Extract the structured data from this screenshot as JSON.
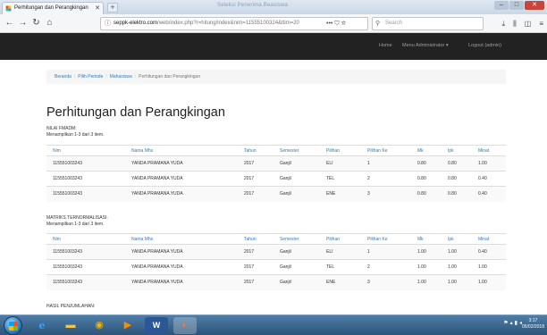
{
  "browser": {
    "tab_title": "Perhitungan dan Perangkingan",
    "window_title": "Seleksi Penerima Beasiswa",
    "url_host": "seppk-elektro.com",
    "url_path": "/web/index.php?r=hitung/index&nim=11555100324&ttim=20",
    "search_placeholder": "Search"
  },
  "sitenav": {
    "home": "Home",
    "menu_admin": "Menu Administrator ▾",
    "logout": "Logout (admin)"
  },
  "breadcrumb": {
    "items": [
      "Beranda",
      "Pilih Periode",
      "Mahasiswa"
    ],
    "active": "Perhitungan dan Perangkingan"
  },
  "page": {
    "title": "Perhitungan dan Perangkingan",
    "section1_label": "NILAI FMADM:",
    "section1_summary": "Menampilkan 1-3 dari 3 item.",
    "section2_label": "MATRIKS TERNORMALISASI:",
    "section2_summary": "Menampilkan 1-3 dari 3 item.",
    "section3_label": "HASIL PENJUMLAHAN:"
  },
  "columns": [
    "Nim",
    "Nama Mhs",
    "Tahun",
    "Semester",
    "Pilihan",
    "Pilihan Ke",
    "Mk",
    "Ipk",
    "Minat"
  ],
  "table1": [
    [
      "115551003243",
      "YANDA PRAMANA YUDA",
      "2017",
      "Ganjil",
      "ELI",
      "1",
      "0.80",
      "0.80",
      "1.00"
    ],
    [
      "115551003243",
      "YANDA PRAMANA YUDA",
      "2017",
      "Ganjil",
      "TEL",
      "2",
      "0.80",
      "0.80",
      "0.40"
    ],
    [
      "115551003243",
      "YANDA PRAMANA YUDA",
      "2017",
      "Ganjil",
      "ENE",
      "3",
      "0.80",
      "0.80",
      "0.40"
    ]
  ],
  "table2": [
    [
      "115551003243",
      "YANDA PRAMANA YUDA",
      "2017",
      "Ganjil",
      "ELI",
      "1",
      "1.00",
      "1.00",
      "0.40"
    ],
    [
      "115551003243",
      "YANDA PRAMANA YUDA",
      "2017",
      "Ganjil",
      "TEL",
      "2",
      "1.00",
      "1.00",
      "1.00"
    ],
    [
      "115551003243",
      "YANDA PRAMANA YUDA",
      "2017",
      "Ganjil",
      "ENE",
      "3",
      "1.00",
      "1.00",
      "1.00"
    ]
  ],
  "taskbar": {
    "clock_time": "3:17",
    "clock_date": "05/02/2018"
  }
}
